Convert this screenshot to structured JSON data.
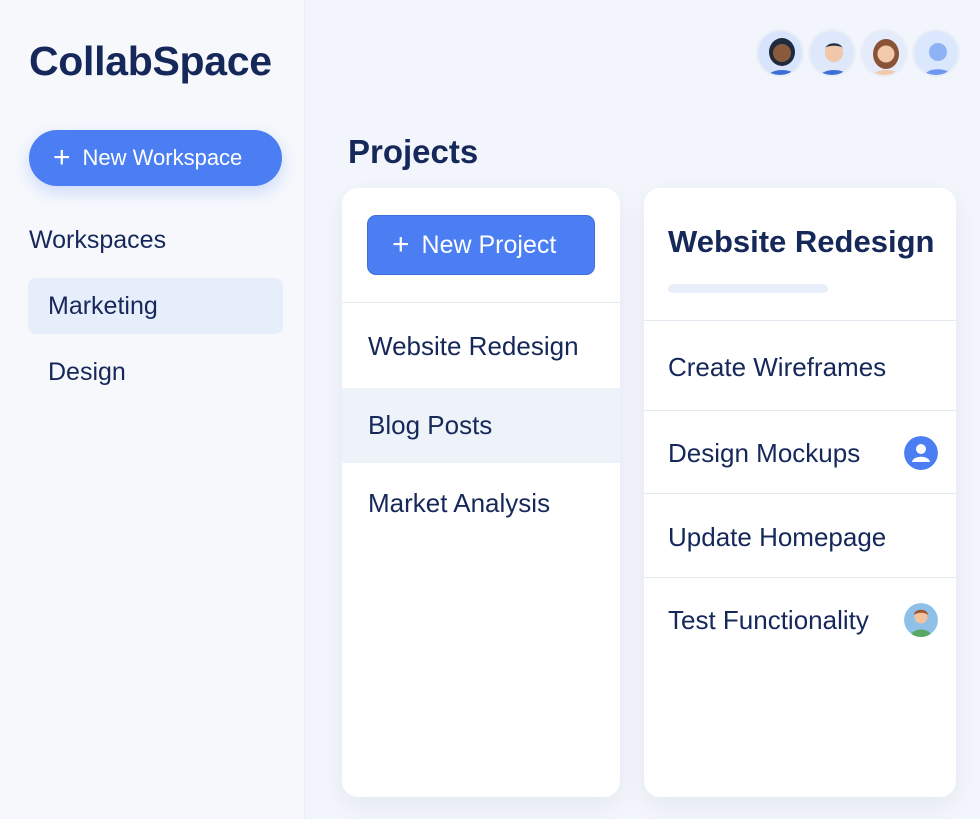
{
  "app": {
    "name": "CollabSpace"
  },
  "sidebar": {
    "new_workspace_label": "New Workspace",
    "workspaces_heading": "Workspaces",
    "items": [
      {
        "label": "Marketing",
        "active": true
      },
      {
        "label": "Design",
        "active": false
      }
    ]
  },
  "header": {
    "avatars": [
      "user-avatar-1",
      "user-avatar-2",
      "user-avatar-3",
      "user-avatar-4"
    ]
  },
  "projects": {
    "title": "Projects",
    "new_project_label": "New Project",
    "items": [
      {
        "label": "Website Redesign",
        "active": false
      },
      {
        "label": "Blog Posts",
        "active": true
      },
      {
        "label": "Market Analysis",
        "active": false
      }
    ]
  },
  "tasks": {
    "project_title": "Website Redesign",
    "progress": 0.0,
    "items": [
      {
        "label": "Create Wireframes",
        "assignee": null
      },
      {
        "label": "Design Mockups",
        "assignee": "default-user-icon"
      },
      {
        "label": "Update Homepage",
        "assignee": null
      },
      {
        "label": "Test Functionality",
        "assignee": "user-avatar"
      }
    ]
  },
  "colors": {
    "accent": "#4a7ef2",
    "text": "#16285a",
    "sidebar_active": "#e6eefc"
  }
}
